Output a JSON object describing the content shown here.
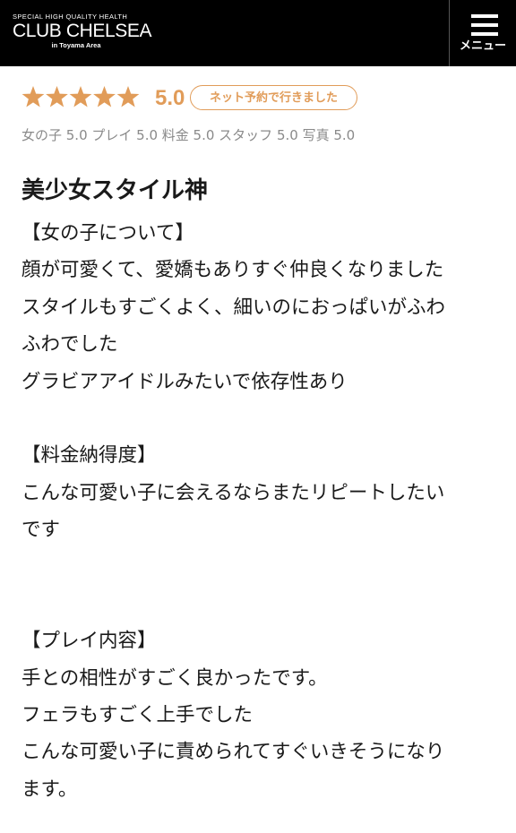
{
  "header": {
    "logo_tagline": "SPECIAL HIGH QUALITY HEALTH",
    "logo_name": "CLUB CHELSEA",
    "logo_area": "in Toyama Area",
    "menu_label": "メニュー",
    "menu_icon": "hamburger-icon",
    "background": "#000000"
  },
  "rating": {
    "stars": 5,
    "max_stars": 5,
    "score": "5.0",
    "badge": "ネット予約で行きました",
    "accent_color": "#e19c59"
  },
  "subscores": "女の子 5.0 プレイ 5.0 料金 5.0 スタッフ 5.0 写真 5.0",
  "review": {
    "title": "美少女スタイル神",
    "lines": [
      "【女の子について】",
      "顔が可愛くて、愛嬌もありすぐ仲良くなりました",
      "スタイルもすごくよく、細いのにおっぱいがふわ",
      "ふわでした",
      "グラビアアイドルみたいで依存性あり",
      "",
      "【料金納得度】",
      "こんな可愛い子に会えるならまたリピートしたい",
      "です",
      "",
      "",
      "【プレイ内容】",
      "手との相性がすごく良かったです。",
      "フェラもすごく上手でした",
      "こんな可愛い子に責められてすぐいきそうになり",
      "ます。"
    ]
  }
}
